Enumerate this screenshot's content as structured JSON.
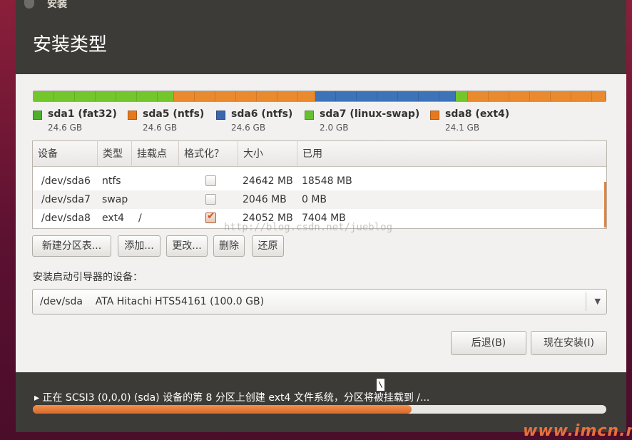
{
  "window": {
    "title": "安装",
    "page_title": "安装类型"
  },
  "partitions": {
    "bar": [
      {
        "name": "sda1",
        "fraction": 0.246,
        "color": "#73c62c"
      },
      {
        "name": "sda5",
        "fraction": 0.246,
        "color": "#ea8a2f"
      },
      {
        "name": "sda6",
        "fraction": 0.246,
        "color": "#3d73b8"
      },
      {
        "name": "sda7",
        "fraction": 0.02,
        "color": "#73c62c"
      },
      {
        "name": "sda8",
        "fraction": 0.241,
        "color": "#ea8a2f"
      }
    ],
    "legend": [
      {
        "name": "sda1 (fat32)",
        "size": "24.6 GB",
        "color": "#4fae2c"
      },
      {
        "name": "sda5 (ntfs)",
        "size": "24.6 GB",
        "color": "#e6781e"
      },
      {
        "name": "sda6 (ntfs)",
        "size": "24.6 GB",
        "color": "#3a67ad"
      },
      {
        "name": "sda7 (linux-swap)",
        "size": "2.0 GB",
        "color": "#66c12f"
      },
      {
        "name": "sda8 (ext4)",
        "size": "24.1 GB",
        "color": "#e6781e"
      }
    ]
  },
  "table": {
    "headers": [
      "设备",
      "类型",
      "挂载点",
      "格式化？",
      "大小",
      "已用"
    ],
    "rows": [
      {
        "device": "/dev/sda6",
        "type": "ntfs",
        "mount": "",
        "format": false,
        "size": "24642 MB",
        "used": "18548 MB"
      },
      {
        "device": "/dev/sda7",
        "type": "swap",
        "mount": "",
        "format": false,
        "size": "2046 MB",
        "used": "0 MB"
      },
      {
        "device": "/dev/sda8",
        "type": "ext4",
        "mount": "/",
        "format": true,
        "size": "24052 MB",
        "used": "7404 MB"
      }
    ]
  },
  "actions": {
    "new_table": "新建分区表...",
    "add": "添加...",
    "change": "更改...",
    "delete": "删除",
    "revert": "还原"
  },
  "bootloader": {
    "label": "安装启动引导器的设备：",
    "device": "/dev/sda",
    "description": "ATA Hitachi HTS54161 (100.0 GB)"
  },
  "nav": {
    "back": "后退(B)",
    "install_now": "现在安装(I)"
  },
  "status": {
    "message": "▸ 正在 SCSI3 (0,0,0) (sda) 设备的第 8 分区上创建 ext4 文件系统，分区将被挂载到 /...",
    "progress": 0.66
  },
  "overlay": {
    "watermark": "http://blog.csdn.net/jueblog",
    "site_mark": "www.imcn.me",
    "cursor_glyph": "\\"
  }
}
